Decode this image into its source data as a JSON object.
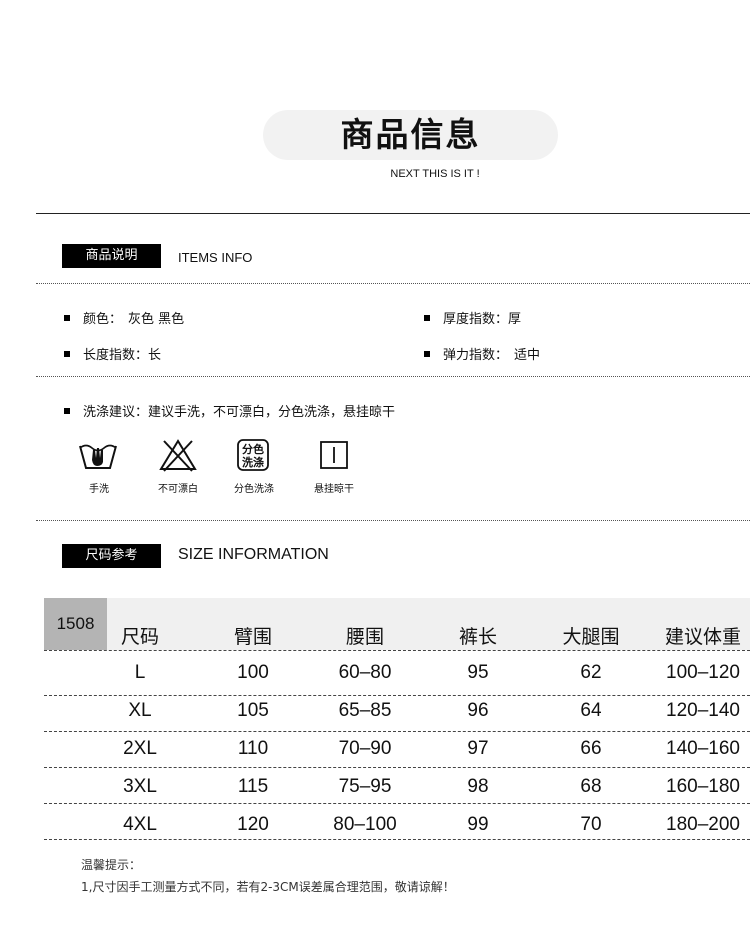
{
  "header": {
    "title": "商品信息",
    "subtitle": "NEXT THIS IS IT !"
  },
  "items_section": {
    "label": "商品说明",
    "label_en": "ITEMS INFO"
  },
  "attributes": [
    {
      "label": "颜色：",
      "value": "灰色 黑色"
    },
    {
      "label": "厚度指数：",
      "value": "厚"
    },
    {
      "label": "长度指数：",
      "value": "长"
    },
    {
      "label": "弹力指数：",
      "value": "适中"
    }
  ],
  "washing": {
    "label": "洗涤建议：",
    "value": "建议手洗，不可漂白，分色洗涤，悬挂晾干",
    "icons": [
      {
        "icon": "hand-wash-icon",
        "caption": "手洗"
      },
      {
        "icon": "no-bleach-icon",
        "caption": "不可漂白"
      },
      {
        "icon": "separate-color-wash-icon",
        "caption": "分色洗涤",
        "glyph_top": "分色",
        "glyph_bottom": "洗涤"
      },
      {
        "icon": "hang-dry-icon",
        "caption": "悬挂晾干"
      }
    ]
  },
  "size_section": {
    "label": "尺码参考",
    "label_en": "SIZE INFORMATION"
  },
  "size_table": {
    "code": "1508",
    "headers": [
      "尺码",
      "臂围",
      "腰围",
      "裤长",
      "大腿围",
      "建议体重"
    ],
    "rows": [
      [
        "L",
        "100",
        "60–80",
        "95",
        "62",
        "100–120"
      ],
      [
        "XL",
        "105",
        "65–85",
        "96",
        "64",
        "120–140"
      ],
      [
        "2XL",
        "110",
        "70–90",
        "97",
        "66",
        "140–160"
      ],
      [
        "3XL",
        "115",
        "75–95",
        "98",
        "68",
        "160–180"
      ],
      [
        "4XL",
        "120",
        "80–100",
        "99",
        "70",
        "180–200"
      ]
    ]
  },
  "notes": {
    "title": "温馨提示：",
    "line1": "1,尺寸因手工测量方式不同，若有2-3CM误差属合理范围，敬请谅解！"
  }
}
